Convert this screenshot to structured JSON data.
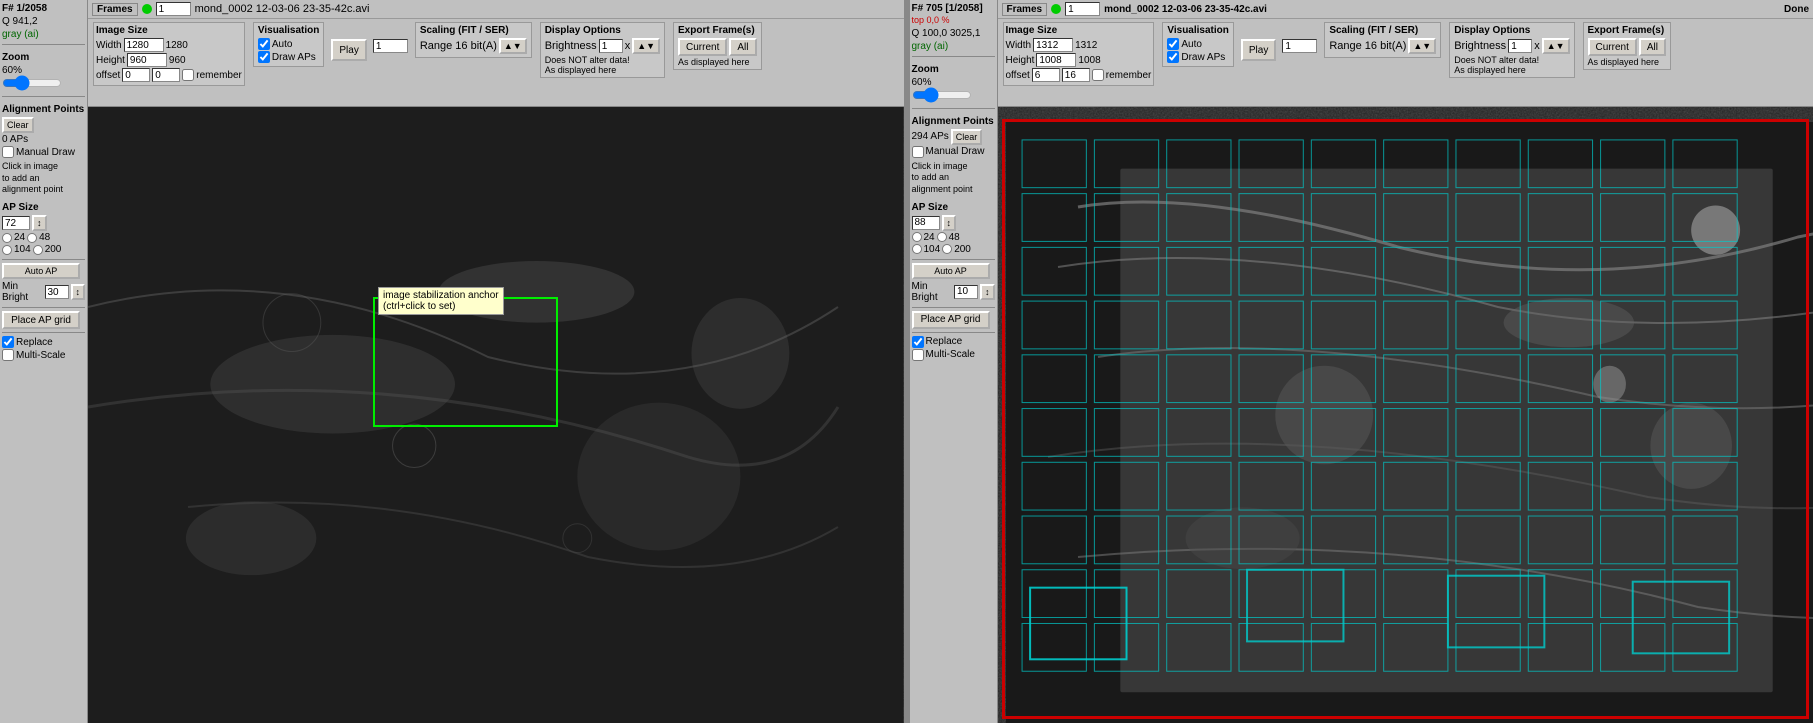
{
  "left_panel": {
    "title": "mond_0002 12-03-06 23-35-42c.avi",
    "frames_label": "Frames",
    "frame_number": "1",
    "image_size": {
      "label": "Image Size",
      "width_label": "Width",
      "width_value": "1280",
      "height_label": "Height",
      "height_value": "960"
    },
    "offset": {
      "label": "offset",
      "value": "0 ; 0"
    },
    "remember_label": "remember",
    "visualisation": {
      "label": "Visualisation",
      "auto_checked": true,
      "auto_label": "Auto",
      "draw_aps_checked": true,
      "draw_aps_label": "Draw APs"
    },
    "play_btn": "Play",
    "scaling": {
      "label": "Scaling (FIT / SER)",
      "range_label": "Range 16 bit(A)"
    },
    "display_options": {
      "label": "Display Options",
      "brightness_label": "Brightness",
      "brightness_value": "1",
      "brightness_unit": "x",
      "does_not_alter": "Does NOT alter data!",
      "as_displayed": "As displayed here"
    },
    "export": {
      "label": "Export Frame(s)",
      "current_btn": "Current",
      "all_btn": "All"
    },
    "frame_info": {
      "frame": "F# 1/2058",
      "q_value": "Q  941,2",
      "gray_ai": "gray (ai)"
    },
    "zoom": {
      "label": "Zoom",
      "value": "60%"
    },
    "alignment_points": {
      "label": "Alignment Points",
      "count": "0 APs",
      "clear_btn": "Clear",
      "manual_draw_label": "Manual Draw",
      "click_info": "Click in image\nto add an\nalignment point",
      "ap_size_label": "AP Size",
      "ap_size_value": "72",
      "radio_24": "24",
      "radio_48": "48",
      "radio_104": "104",
      "radio_200": "200",
      "auto_ap_btn": "Auto AP",
      "min_bright_label": "Min Bright",
      "min_bright_value": "30",
      "place_ap_grid_btn": "Place AP grid",
      "replace_label": "Replace",
      "replace_checked": true,
      "multi_scale_label": "Multi-Scale",
      "multi_scale_checked": false
    },
    "tooltip": {
      "text1": "image stabilization anchor",
      "text2": "(ctrl+click to set)"
    }
  },
  "right_panel": {
    "title": "mond_0002 12-03-06 23-35-42c.avi",
    "done_label": "Done",
    "frames_label": "Frames",
    "frame_number": "1",
    "image_size": {
      "label": "Image Size",
      "width_label": "Width",
      "width_value": "1312",
      "height_label": "Height",
      "height_value": "1008"
    },
    "offset": {
      "label": "offset",
      "value": "6 ; 16"
    },
    "remember_label": "remember",
    "visualisation": {
      "label": "Visualisation",
      "auto_checked": true,
      "auto_label": "Auto",
      "draw_aps_checked": true,
      "draw_aps_label": "Draw APs"
    },
    "play_btn": "Play",
    "scaling": {
      "label": "Scaling (FIT / SER)",
      "range_label": "Range 16 bit(A)"
    },
    "display_options": {
      "label": "Display Options",
      "brightness_label": "Brightness",
      "brightness_value": "1",
      "brightness_unit": "x",
      "does_not_alter": "Does NOT alter data!",
      "as_displayed": "As displayed here"
    },
    "export": {
      "label": "Export Frame(s)",
      "current_btn": "Current",
      "all_btn": "All"
    },
    "frame_info": {
      "frame": "F# 705 [1/2058]",
      "top_pct": "top 0,0 %",
      "q_value": "Q 100,0  3025,1",
      "gray_ai": "gray (ai)"
    },
    "zoom": {
      "label": "Zoom",
      "value": "60%"
    },
    "alignment_points": {
      "label": "Alignment Points",
      "count": "294 APs",
      "clear_btn": "Clear",
      "manual_draw_label": "Manual Draw",
      "click_info": "Click in image\nto add an\nalignment point",
      "ap_size_label": "AP Size",
      "ap_size_value": "88",
      "radio_24": "24",
      "radio_48": "48",
      "radio_104": "104",
      "radio_200": "200",
      "auto_ap_btn": "Auto AP",
      "min_bright_label": "Min Bright",
      "min_bright_value": "10",
      "place_ap_grid_btn": "Place AP grid",
      "replace_label": "Replace",
      "replace_checked": true,
      "multi_scale_label": "Multi-Scale",
      "multi_scale_checked": false
    }
  }
}
